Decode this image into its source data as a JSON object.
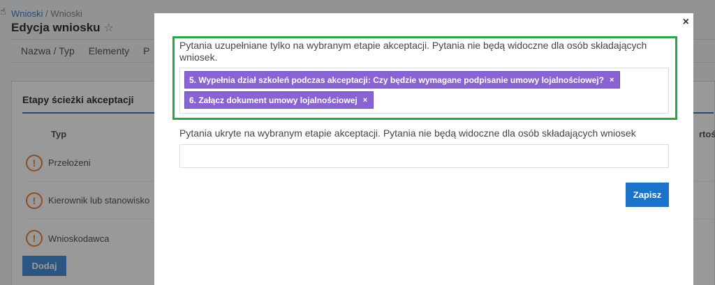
{
  "breadcrumb": {
    "link": "Wnioski",
    "separator": " / ",
    "current": "Wnioski"
  },
  "page": {
    "title": "Edycja wniosku",
    "star_icon": "star-outline-icon"
  },
  "tabs": [
    "Nazwa / Typ",
    "Elementy",
    "P"
  ],
  "card": {
    "title": "Etapy ścieżki akceptacji",
    "col_typ": "Typ",
    "col_right": "rtości",
    "rows": [
      "Przełożeni",
      "Kierownik lub stanowisko",
      "Wnioskodawca"
    ],
    "add_button": "Dodaj"
  },
  "modal": {
    "close": "×",
    "field1": {
      "label": "Pytania uzupełniane tylko na wybranym etapie akceptacji. Pytania nie będą widoczne dla osób składających wniosek.",
      "tags": [
        "5. Wypełnia dział szkoleń podczas akceptacji: Czy będzie wymagane podpisanie umowy lojalnościowej?",
        "6. Załącz dokument umowy lojalnościowej"
      ],
      "tag_remove": "×"
    },
    "field2": {
      "label": "Pytania ukryte na wybranym etapie akceptacji. Pytania nie będą widoczne dla osób składających wniosek",
      "value": ""
    },
    "save_button": "Zapisz"
  },
  "colors": {
    "accent": "#1a73c8",
    "tag": "#8a63d2",
    "highlight": "#27a844",
    "warning": "#e8833a"
  }
}
